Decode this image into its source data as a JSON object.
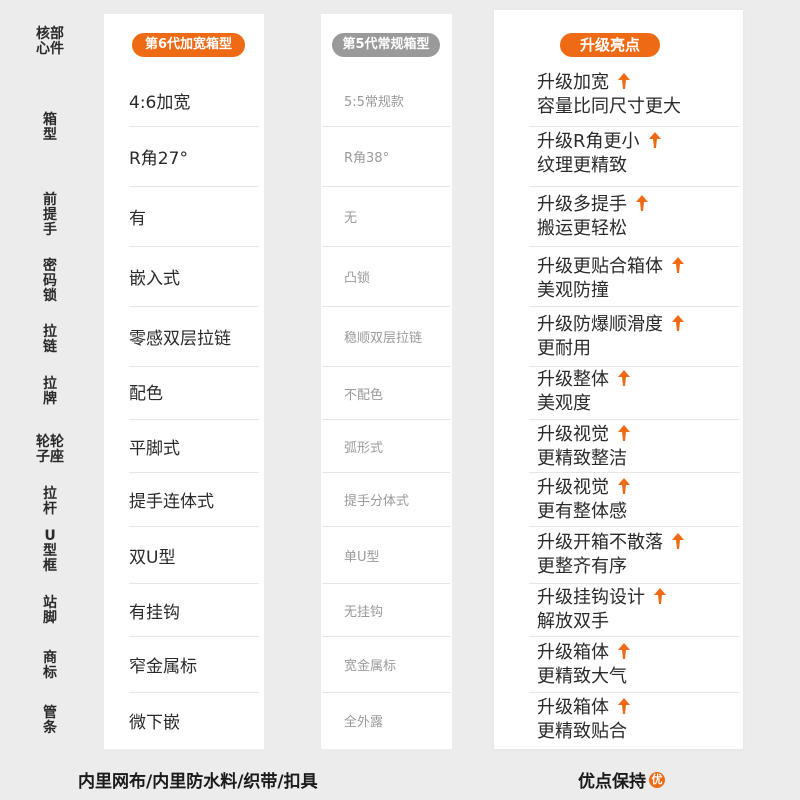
{
  "header": {
    "core_parts_label": [
      "核部",
      "心件"
    ],
    "gen6_title": "第6代加宽箱型",
    "gen5_title": "第5代常规箱型",
    "highlights_title": "升级亮点"
  },
  "rows": [
    {
      "label": [
        "箱",
        "型"
      ],
      "gen6": "4:6加宽",
      "gen5": "5:5常规款",
      "hl1": "升级加宽",
      "hl2": "容量比同尺寸更大"
    },
    {
      "label": [],
      "gen6": "R角27°",
      "gen5": "R角38°",
      "hl1": "升级R角更小",
      "hl2": "纹理更精致"
    },
    {
      "label": [
        "前",
        "提",
        "手"
      ],
      "gen6": "有",
      "gen5": "无",
      "hl1": "升级多提手",
      "hl2": "搬运更轻松"
    },
    {
      "label": [
        "密",
        "码",
        "锁"
      ],
      "gen6": "嵌入式",
      "gen5": "凸锁",
      "hl1": "升级更贴合箱体",
      "hl2": "美观防撞"
    },
    {
      "label": [
        "拉",
        "链"
      ],
      "gen6": "零感双层拉链",
      "gen5": "稳顺双层拉链",
      "hl1": "升级防爆顺滑度",
      "hl2": "更耐用"
    },
    {
      "label": [
        "拉",
        "牌"
      ],
      "gen6": "配色",
      "gen5": "不配色",
      "hl1": "升级整体",
      "hl2": "美观度"
    },
    {
      "label": [
        "轮轮",
        "子座"
      ],
      "gen6": "平脚式",
      "gen5": "弧形式",
      "hl1": "升级视觉",
      "hl2": "更精致整洁"
    },
    {
      "label": [
        "拉",
        "杆"
      ],
      "gen6": "提手连体式",
      "gen5": "提手分体式",
      "hl1": "升级视觉",
      "hl2": "更有整体感"
    },
    {
      "label": [
        "U",
        "型",
        "框"
      ],
      "gen6": "双U型",
      "gen5": "单U型",
      "hl1": "升级开箱不散落",
      "hl2": "更整齐有序"
    },
    {
      "label": [
        "站",
        "脚"
      ],
      "gen6": "有挂钩",
      "gen5": "无挂钩",
      "hl1": "升级挂钩设计",
      "hl2": "解放双手"
    },
    {
      "label": [
        "商",
        "标"
      ],
      "gen6": "窄金属标",
      "gen5": "宽金属标",
      "hl1": "升级箱体",
      "hl2": "更精致大气"
    },
    {
      "label": [
        "管",
        "条"
      ],
      "gen6": "微下嵌",
      "gen5": "全外露",
      "hl1": "升级箱体",
      "hl2": "更精致贴合"
    }
  ],
  "footer": {
    "left_text": "内里网布/内里防水料/织带/扣具",
    "right_text": "优点保持",
    "badge_text": "优"
  },
  "colors": {
    "accent": "#ee6a15",
    "gray_pill": "#9a9a9a",
    "background": "#ececec"
  }
}
